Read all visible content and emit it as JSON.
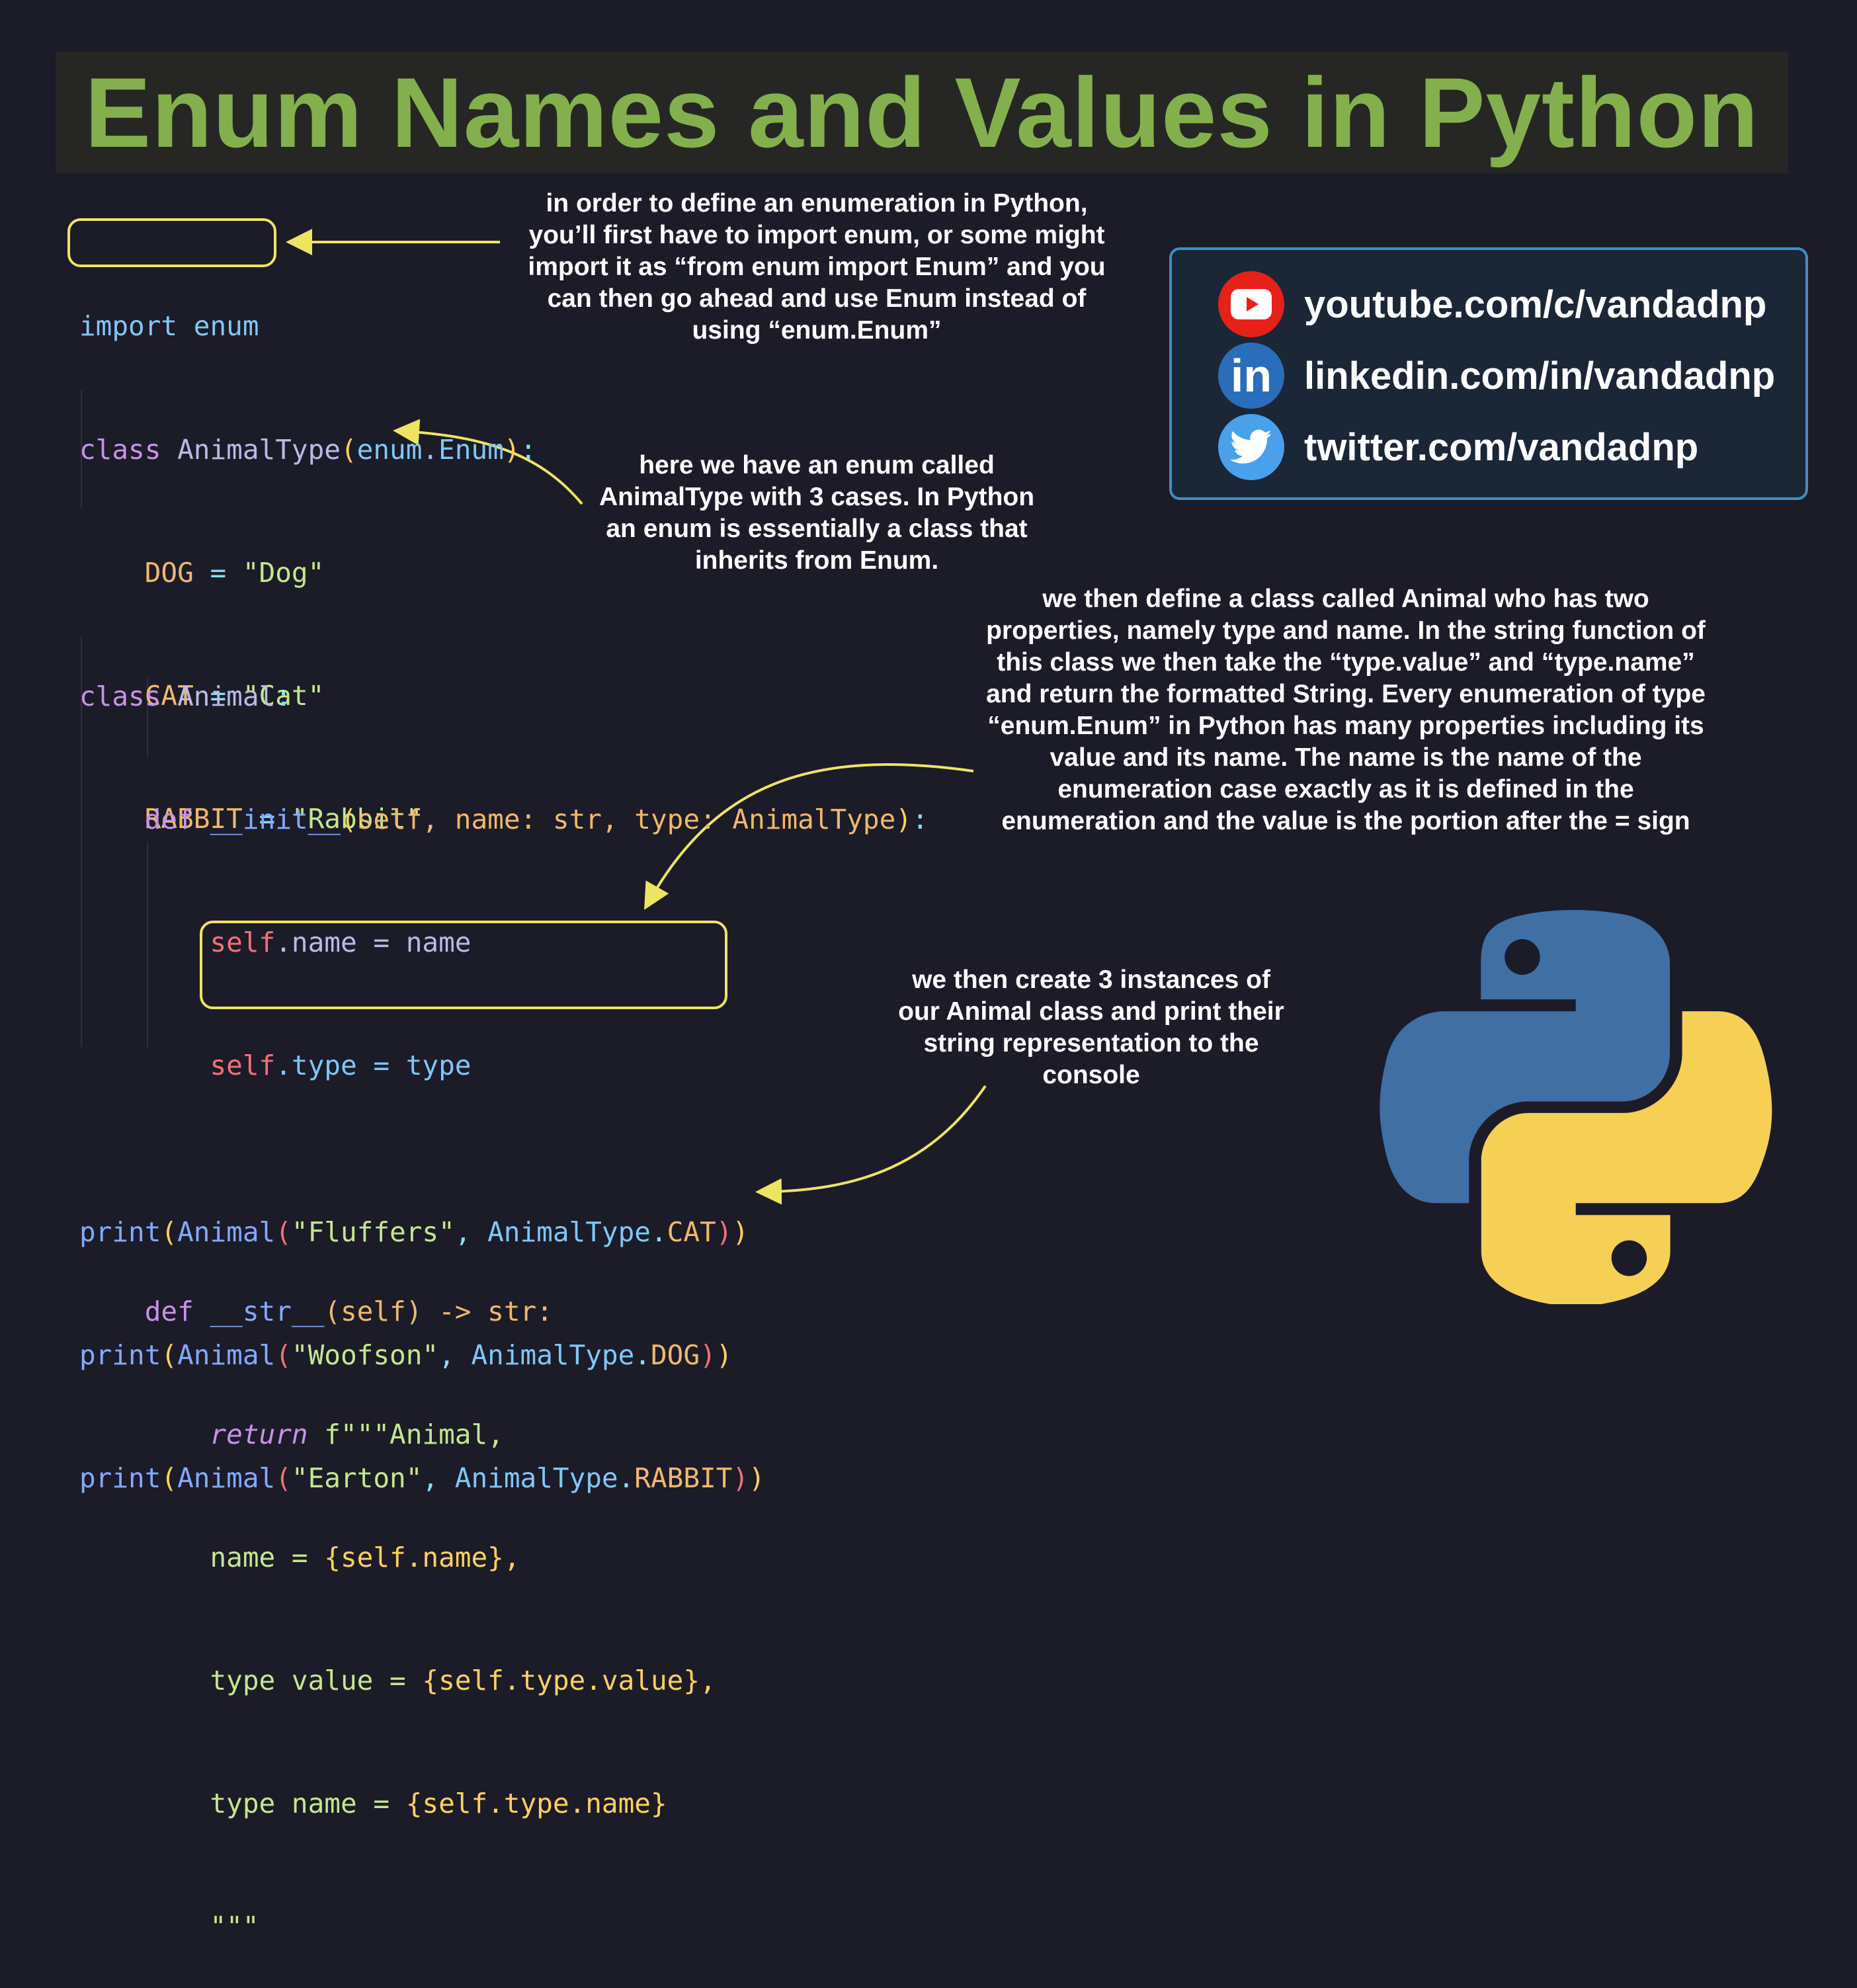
{
  "title": "Enum Names and Values in Python",
  "code": {
    "import_line": "import enum",
    "class_animal_type": {
      "kw": "class",
      "name": "AnimalType",
      "base": "enum.Enum",
      "cases": [
        {
          "name": "DOG",
          "value": "\"Dog\""
        },
        {
          "name": "CAT",
          "value": "\"Cat\""
        },
        {
          "name": "RABBIT",
          "value": "\"Rabbit\""
        }
      ]
    },
    "class_animal": {
      "kw": "class",
      "name": "Animal",
      "init_sig_def": "def",
      "init_name": "__init__",
      "init_params": "self, name: str, type: AnimalType",
      "init_body_1_obj": "self",
      "init_body_1_rest": ".name = name",
      "init_body_2_obj": "self",
      "init_body_2_rest": ".type = type",
      "str_def": "def",
      "str_name": "__str__",
      "str_sig_rest": "(self) -> str:",
      "return_kw": "return",
      "return_start": "f\"\"\"Animal,",
      "line_name_prefix": "name = ",
      "line_name_expr": "{self.name},",
      "line_value_prefix": "type value = ",
      "line_value_expr": "{self.type.value},",
      "line_typename_prefix": "type name = ",
      "line_typename_expr": "{self.type.name}",
      "closing": "\"\"\""
    },
    "prints": [
      {
        "fn": "print",
        "cls": "Animal",
        "arg": "\"Fluffers\"",
        "enum": "AnimalType",
        "case": "CAT"
      },
      {
        "fn": "print",
        "cls": "Animal",
        "arg": "\"Woofson\"",
        "enum": "AnimalType",
        "case": "DOG"
      },
      {
        "fn": "print",
        "cls": "Animal",
        "arg": "\"Earton\"",
        "enum": "AnimalType",
        "case": "RABBIT"
      }
    ]
  },
  "notes": {
    "import_note": "in order to define an enumeration in Python, you’ll first have to import enum, or some might import it as “from enum import Enum” and you can then go ahead and use Enum instead of using “enum.Enum”",
    "enum_note": "here we have an enum called AnimalType with 3 cases. In Python an enum is essentially a class that inherits from Enum.",
    "class_note": "we then define a class called Animal who has two properties, namely type and name. In the string function of this class we then take the “type.value” and “type.name” and return the formatted String. Every enumeration of type “enum.Enum” in Python has many properties including its value and its name. The name is the name of the enumeration case exactly as it is defined in the enumeration and the value is the portion after the = sign",
    "instances_note": "we then create 3 instances of our Animal class and print their string representation to the console"
  },
  "social": {
    "youtube": "youtube.com/c/vandadnp",
    "linkedin": "linkedin.com/in/vandadnp",
    "twitter": "twitter.com/vandadnp",
    "linkedin_glyph": "in"
  },
  "colors": {
    "background": "#1c1b28",
    "title": "#83b04c",
    "highlight": "#ede562",
    "youtube": "#e62117",
    "linkedin": "#2a6ebb",
    "twitter": "#4aa1eb",
    "python_blue": "#3f6fa3",
    "python_yellow": "#f6cf55"
  },
  "icons": [
    "youtube-icon",
    "linkedin-icon",
    "twitter-icon",
    "python-logo"
  ]
}
